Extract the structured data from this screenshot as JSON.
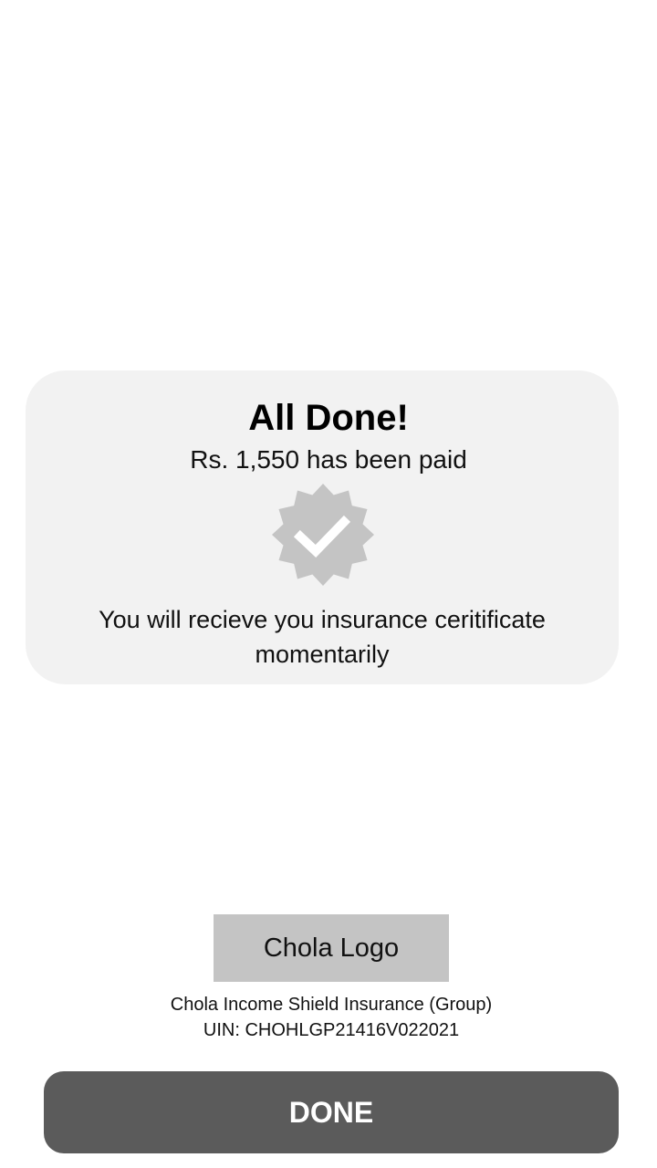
{
  "card": {
    "title": "All Done!",
    "amount_text": "Rs. 1,550 has been paid",
    "message": "You will recieve you insurance ceritificate momentarily",
    "badge_icon": "verified-check-badge-icon"
  },
  "footer": {
    "logo_label": "Chola Logo",
    "product_name": "Chola Income Shield Insurance (Group)",
    "uin": "UIN: CHOHLGP21416V022021"
  },
  "actions": {
    "done_label": "DONE"
  },
  "colors": {
    "card_background": "#f2f2f2",
    "badge": "#c4c4c4",
    "logo_placeholder": "#c4c4c4",
    "button_background": "#5b5b5b",
    "button_text": "#ffffff"
  }
}
